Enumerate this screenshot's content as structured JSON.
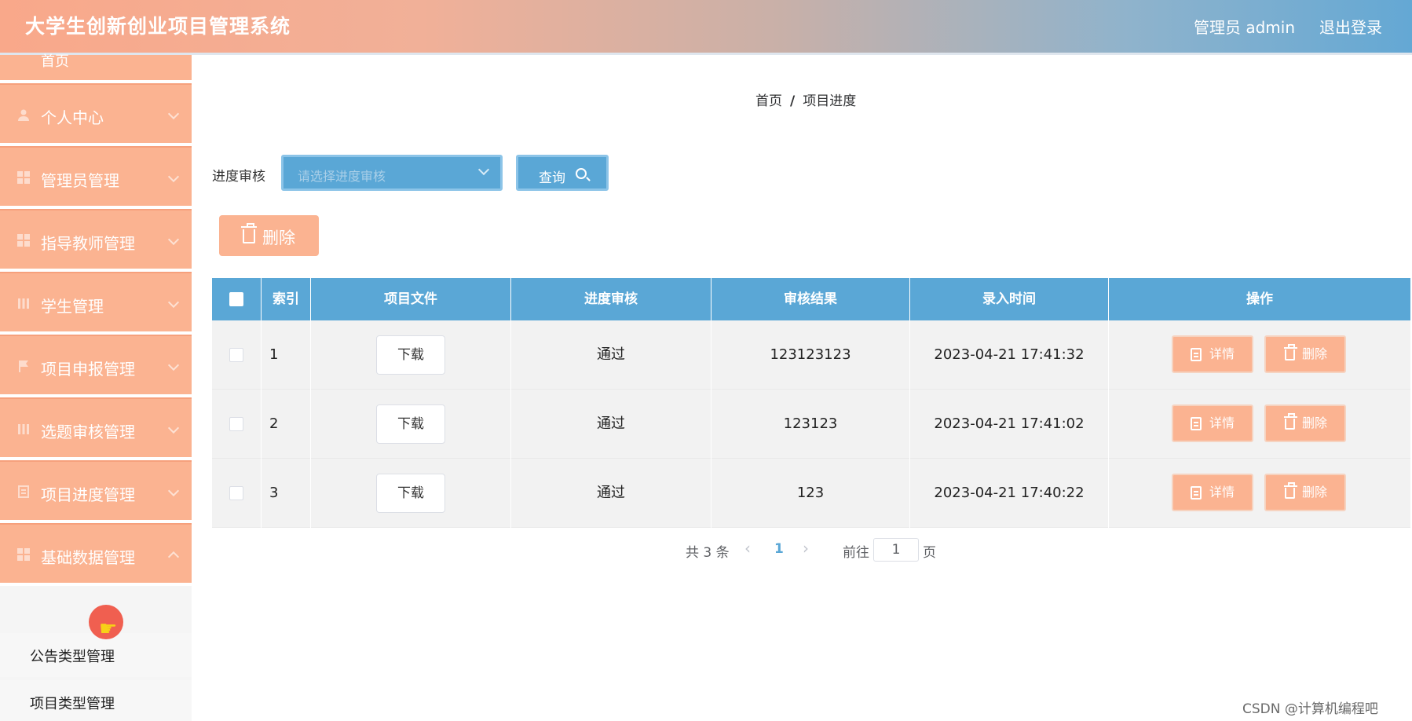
{
  "app": {
    "title": "大学生创新创业项目管理系统",
    "user_label": "管理员 admin",
    "logout_label": "退出登录"
  },
  "sidebar": {
    "top_item_label": "首页",
    "items": [
      {
        "label": "个人中心",
        "icon": "person-icon"
      },
      {
        "label": "管理员管理",
        "icon": "grid-icon"
      },
      {
        "label": "指导教师管理",
        "icon": "grid-icon"
      },
      {
        "label": "学生管理",
        "icon": "grid-icon"
      },
      {
        "label": "项目申报管理",
        "icon": "flag-icon"
      },
      {
        "label": "选题审核管理",
        "icon": "grid-icon"
      },
      {
        "label": "项目进度管理",
        "icon": "list-icon"
      },
      {
        "label": "基础数据管理",
        "icon": "grid-icon"
      }
    ],
    "submenu": [
      {
        "label": "公告类型管理"
      },
      {
        "label": "项目类型管理"
      }
    ]
  },
  "breadcrumb": {
    "home": "首页",
    "separator": "/",
    "current": "项目进度"
  },
  "filter": {
    "label": "进度审核",
    "placeholder": "请选择进度审核",
    "query_label": "查询"
  },
  "toolbar": {
    "delete_label": "删除"
  },
  "table": {
    "headers": [
      "索引",
      "项目文件",
      "进度审核",
      "审核结果",
      "录入时间",
      "操作"
    ],
    "rows": [
      {
        "index": "1",
        "file": "下载",
        "review": "通过",
        "result": "123123123",
        "time": "2023-04-21 17:41:32",
        "detail": "详情",
        "delete": "删除"
      },
      {
        "index": "2",
        "file": "下载",
        "review": "通过",
        "result": "123123",
        "time": "2023-04-21 17:41:02",
        "detail": "详情",
        "delete": "删除"
      },
      {
        "index": "3",
        "file": "下载",
        "review": "通过",
        "result": "123",
        "time": "2023-04-21 17:40:22",
        "detail": "详情",
        "delete": "删除"
      }
    ]
  },
  "pagination": {
    "total": "共 3 条",
    "prev": "‹",
    "current": "1",
    "next": "›",
    "goto": "前往",
    "goto_value": "1",
    "page_unit": "页"
  },
  "watermark": "CSDN @计算机编程吧",
  "colors": {
    "accent_orange": "#fbb391",
    "accent_blue": "#5aa7d6"
  }
}
